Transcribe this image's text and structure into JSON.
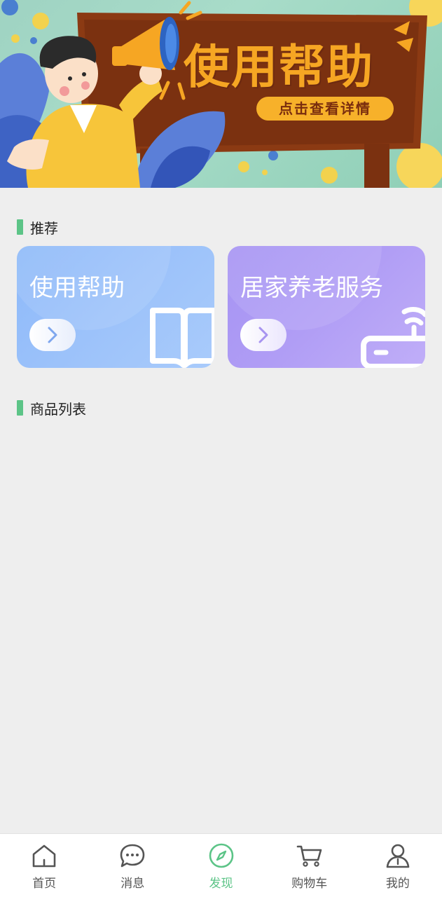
{
  "banner": {
    "title": "使用帮助",
    "pill": "点击查看详情"
  },
  "sections": {
    "recommend": "推荐",
    "products": "商品列表"
  },
  "cards": [
    {
      "title": "使用帮助",
      "icon": "book-icon"
    },
    {
      "title": "居家养老服务",
      "icon": "router-icon"
    }
  ],
  "tabbar": {
    "active": 2,
    "items": [
      {
        "label": "首页",
        "icon": "home-icon"
      },
      {
        "label": "消息",
        "icon": "chat-icon"
      },
      {
        "label": "发现",
        "icon": "compass-icon"
      },
      {
        "label": "购物车",
        "icon": "cart-icon"
      },
      {
        "label": "我的",
        "icon": "user-icon"
      }
    ]
  },
  "colors": {
    "accent": "#5cc487",
    "card_help": "#8db9f9",
    "card_elder": "#a593f3",
    "banner_board": "#8b3a13",
    "banner_text": "#f6a623"
  }
}
